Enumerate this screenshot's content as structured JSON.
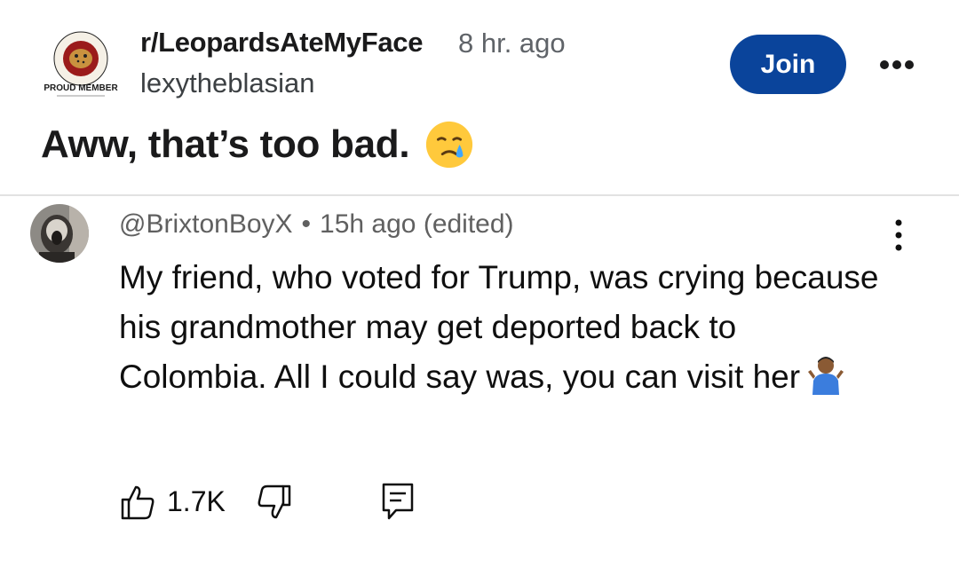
{
  "post": {
    "subreddit": "r/LeopardsAteMyFace",
    "time_ago": "8 hr. ago",
    "username": "lexytheblasian",
    "join_label": "Join",
    "title": "Aww, that’s too bad.",
    "badge_text": "PROUD MEMBER",
    "badge_emoji": "crying-face-emoji"
  },
  "comment": {
    "handle": "@BrixtonBoyX",
    "separator": "•",
    "time_ago": "15h ago (edited)",
    "text": "My friend, who voted for Trump, was crying because his grandmother may get deported back to Colombia. All I could say was, you can visit her",
    "end_emoji": "person-shrugging-emoji",
    "like_count": "1.7K"
  },
  "colors": {
    "join_button": "#0a449b",
    "meta_text": "#606060",
    "divider": "#e2e2e2"
  }
}
